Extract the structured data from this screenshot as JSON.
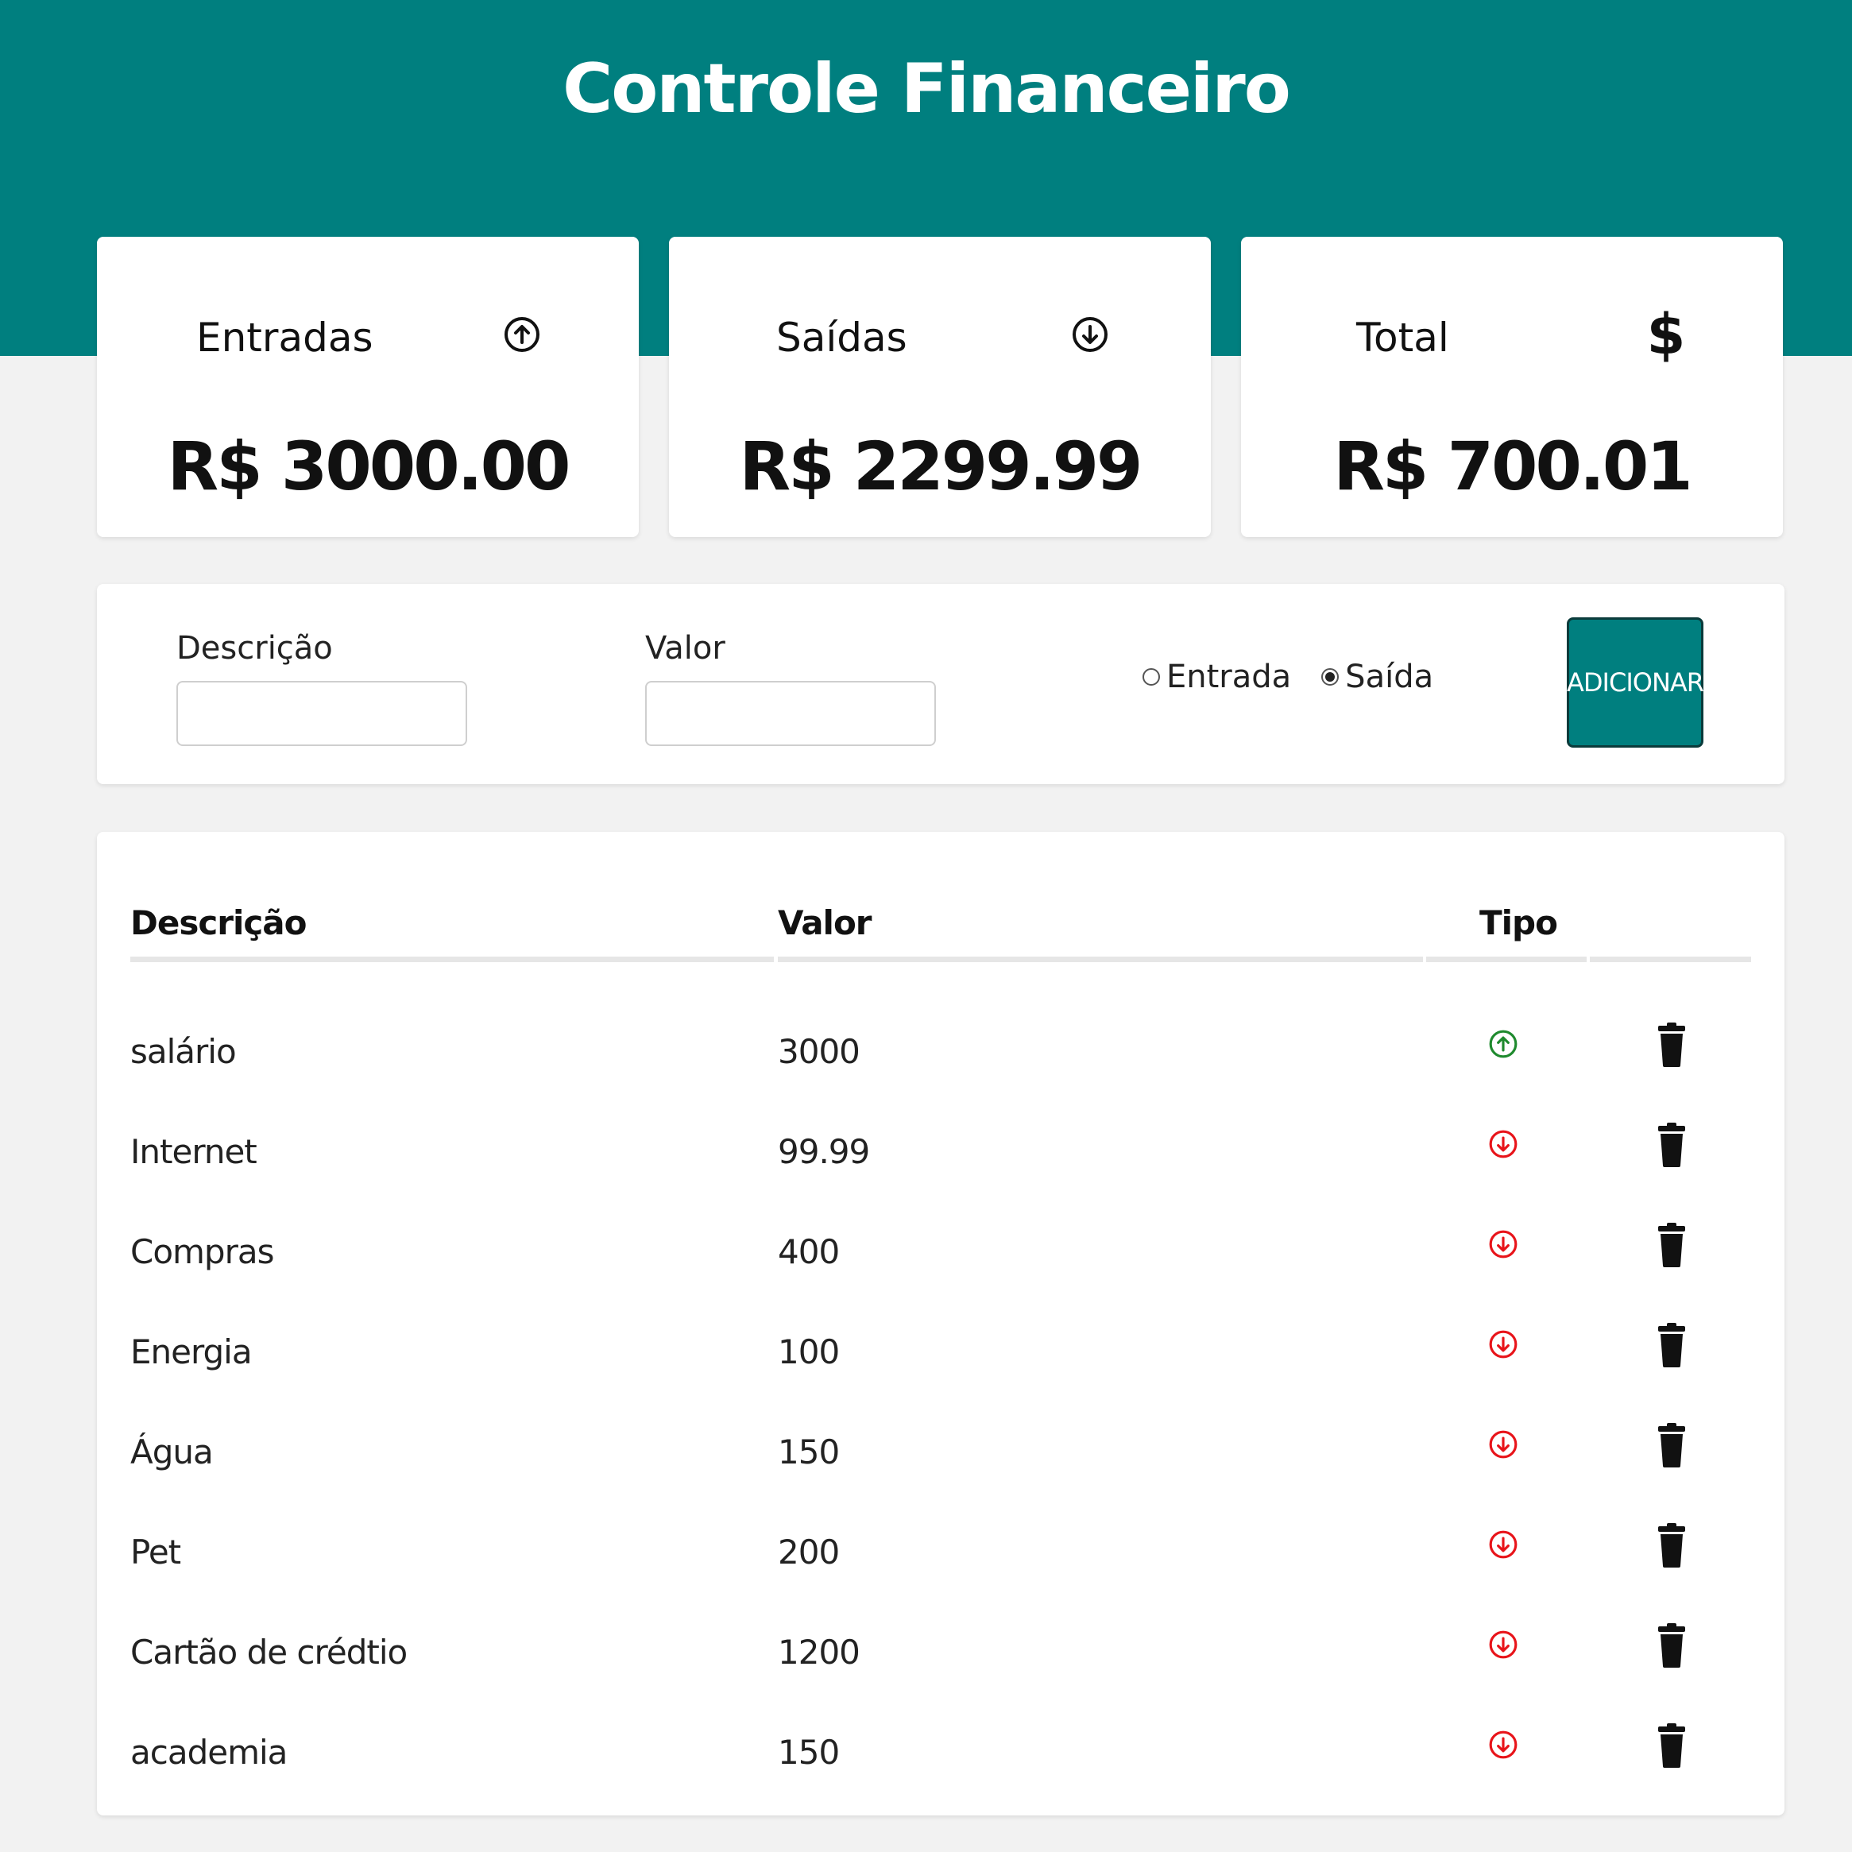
{
  "app": {
    "title": "Controle Financeiro"
  },
  "summary": [
    {
      "label": "Entradas",
      "value": "R$ 3000.00",
      "icon": "arrow-up-circle-icon"
    },
    {
      "label": "Saídas",
      "value": "R$ 2299.99",
      "icon": "arrow-down-circle-icon"
    },
    {
      "label": "Total",
      "value": "R$ 700.01",
      "icon": "dollar-icon",
      "symbol": "$"
    }
  ],
  "form": {
    "description_label": "Descrição",
    "description_value": "",
    "value_label": "Valor",
    "value_value": "",
    "radio_entrada": "Entrada",
    "radio_saida": "Saída",
    "selected": "Saída",
    "add_button": "ADICIONAR"
  },
  "table": {
    "headers": {
      "description": "Descrição",
      "value": "Valor",
      "type": "Tipo"
    },
    "rows": [
      {
        "description": "salário",
        "value": "3000",
        "type": "entrada"
      },
      {
        "description": "Internet",
        "value": "99.99",
        "type": "saida"
      },
      {
        "description": "Compras",
        "value": "400",
        "type": "saida"
      },
      {
        "description": "Energia",
        "value": "100",
        "type": "saida"
      },
      {
        "description": "Água",
        "value": "150",
        "type": "saida"
      },
      {
        "description": "Pet",
        "value": "200",
        "type": "saida"
      },
      {
        "description": "Cartão de crédtio",
        "value": "1200",
        "type": "saida"
      },
      {
        "description": "academia",
        "value": "150",
        "type": "saida"
      }
    ]
  },
  "colors": {
    "brand": "#007f7f",
    "income": "#1f8a2e",
    "expense": "#e8141a",
    "background": "#f2f2f2"
  }
}
